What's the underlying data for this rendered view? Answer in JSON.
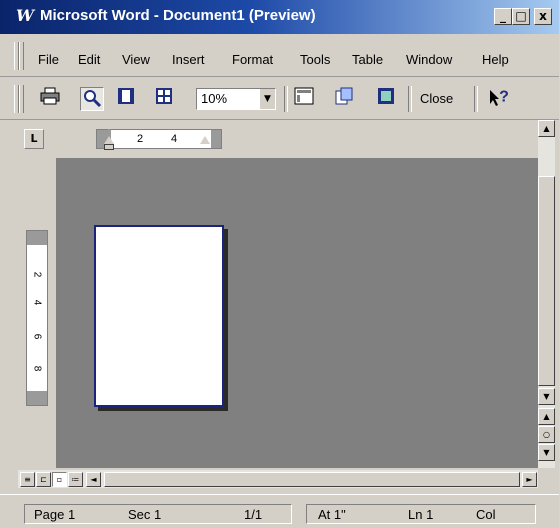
{
  "window": {
    "title": "Microsoft Word - Document1 (Preview)",
    "app_icon": "W",
    "controls": {
      "minimize": "_",
      "maximize": "□",
      "close": "x"
    }
  },
  "menubar": {
    "items": [
      "File",
      "Edit",
      "View",
      "Insert",
      "Format",
      "Tools",
      "Table",
      "Window",
      "Help"
    ]
  },
  "toolbar": {
    "zoom_value": "10%",
    "close_label": "Close",
    "help_label": "?",
    "icons": [
      "print-icon",
      "magnifier-icon",
      "one-page-icon",
      "multiple-pages-icon",
      "zoom-dropdown-arrow-icon",
      "view-ruler-icon",
      "shrink-to-fit-icon",
      "full-screen-icon",
      "context-help-icon"
    ]
  },
  "ruler": {
    "tab_selector": "L",
    "h_numbers": [
      "2",
      "4"
    ],
    "v_numbers": [
      "2",
      "4",
      "6",
      "8"
    ]
  },
  "scrollbar": {
    "up": "▲",
    "down": "▼",
    "prev_page": "▲",
    "select_browse": "○",
    "next_page": "▼",
    "left": "◄",
    "right": "►"
  },
  "view_buttons": [
    "normal-view",
    "web-layout-view",
    "print-layout-view",
    "outline-view"
  ],
  "statusbar": {
    "page": "Page 1",
    "section": "Sec 1",
    "page_count": "1/1",
    "at": "At 1\"",
    "line": "Ln 1",
    "col": "Col"
  },
  "colors": {
    "title_gradient_start": "#0a246a",
    "title_gradient_end": "#a6caf0",
    "chrome": "#d4d0c8",
    "workspace": "#808080",
    "page_border": "#1a237e"
  }
}
